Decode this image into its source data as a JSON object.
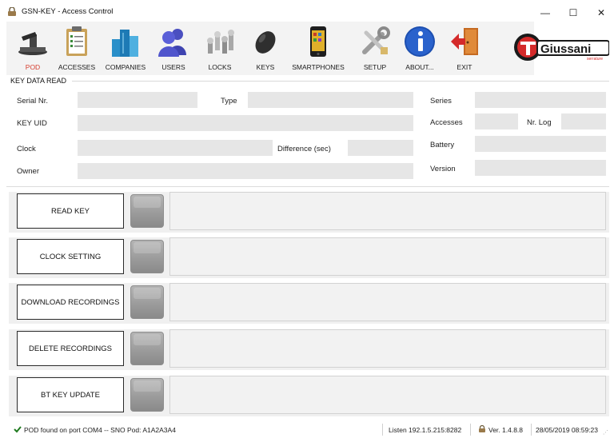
{
  "window": {
    "title": "GSN-KEY - Access Control",
    "minimize_glyph": "—",
    "maximize_glyph": "☐",
    "close_glyph": "✕"
  },
  "toolbar": {
    "items": [
      {
        "label": "POD",
        "icon": "pod-reader-icon",
        "active": true
      },
      {
        "label": "ACCESSES",
        "icon": "clipboard-icon"
      },
      {
        "label": "COMPANIES",
        "icon": "buildings-icon"
      },
      {
        "label": "USERS",
        "icon": "users-icon"
      },
      {
        "label": "LOCKS",
        "icon": "lock-cylinders-icon"
      },
      {
        "label": "KEYS",
        "icon": "key-fob-icon"
      },
      {
        "label": "SMARTPHONES",
        "icon": "smartphone-icon"
      },
      {
        "label": "SETUP",
        "icon": "tools-icon"
      },
      {
        "label": "ABOUT...",
        "icon": "info-icon"
      },
      {
        "label": "EXIT",
        "icon": "exit-door-icon"
      }
    ],
    "active_color": "#d63d2e"
  },
  "logo": {
    "brand": "Giussani",
    "tagline": "serrature"
  },
  "key_data": {
    "section_title": "KEY DATA READ",
    "serial_label": "Serial Nr.",
    "serial_value": "",
    "type_label": "Type",
    "type_value": "",
    "series_label": "Series",
    "series_value": "",
    "uid_label": "KEY UID",
    "uid_value": "",
    "accesses_label": "Accesses",
    "accesses_value": "",
    "nrlog_label": "Nr. Log",
    "nrlog_value": "",
    "clock_label": "Clock",
    "clock_value": "",
    "difference_label": "Difference (sec)",
    "difference_value": "",
    "battery_label": "Battery",
    "battery_value": "",
    "owner_label": "Owner",
    "owner_value": "",
    "version_label": "Version",
    "version_value": ""
  },
  "operations": [
    {
      "label": "READ KEY",
      "output": ""
    },
    {
      "label": "CLOCK SETTING",
      "output": ""
    },
    {
      "label": "DOWNLOAD RECORDINGS",
      "output": ""
    },
    {
      "label": "DELETE RECORDINGS",
      "output": ""
    },
    {
      "label": "BT KEY UPDATE",
      "output": ""
    }
  ],
  "status_bar": {
    "message": "POD found on port COM4 -- SNO Pod: A1A2A3A4",
    "listen": "Listen 192.1.5.215:8282",
    "version": "Ver. 1.4.8.8",
    "datetime": "28/05/2019 08:59:23",
    "ok_color": "#1f7a1f"
  }
}
